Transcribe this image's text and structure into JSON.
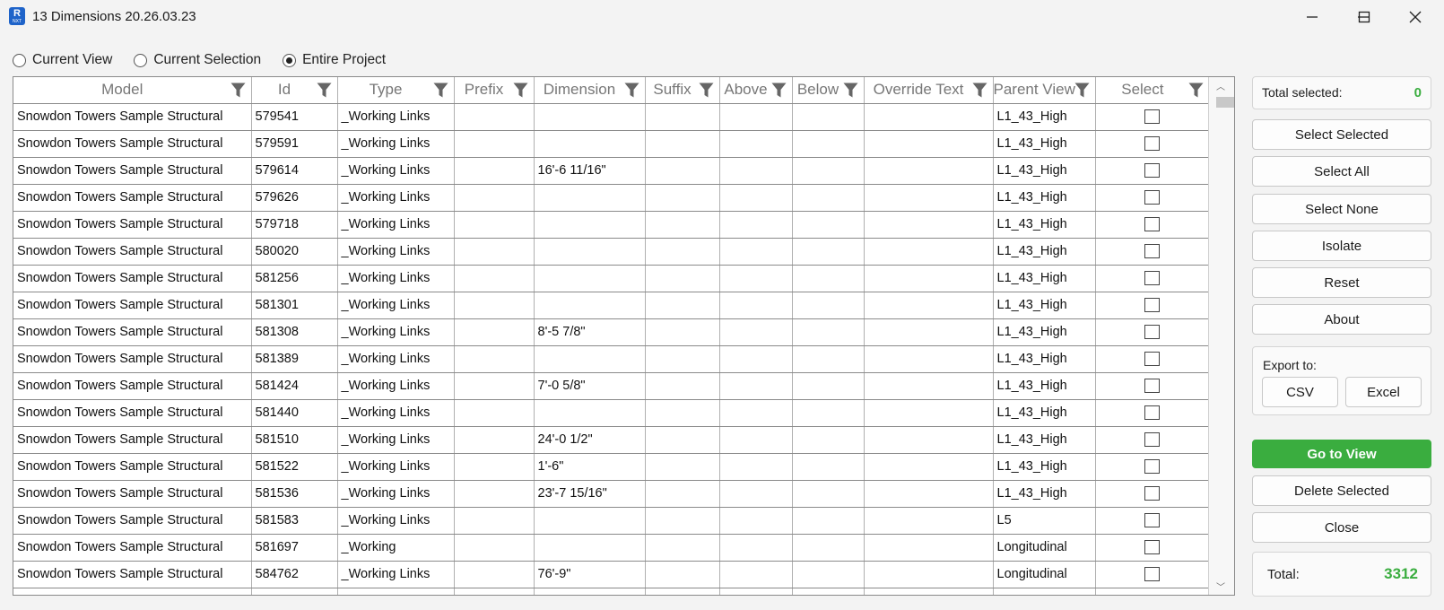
{
  "window": {
    "title": "13 Dimensions 20.26.03.23",
    "icon_letter": "R",
    "icon_sub": "NXT"
  },
  "scope": {
    "options": [
      {
        "label": "Current View",
        "checked": false
      },
      {
        "label": "Current Selection",
        "checked": false
      },
      {
        "label": "Entire Project",
        "checked": true
      }
    ]
  },
  "grid": {
    "columns": [
      "Model",
      "Id",
      "Type",
      "Prefix",
      "Dimension",
      "Suffix",
      "Above",
      "Below",
      "Override Text",
      "Parent View",
      "Select"
    ],
    "rows": [
      {
        "model": "Snowdon Towers Sample Structural",
        "id": "579541",
        "type": "_Working Links",
        "prefix": "",
        "dimension": "",
        "suffix": "",
        "above": "",
        "below": "",
        "override": "",
        "parent": "L1_43_High"
      },
      {
        "model": "Snowdon Towers Sample Structural",
        "id": "579591",
        "type": "_Working Links",
        "prefix": "",
        "dimension": "",
        "suffix": "",
        "above": "",
        "below": "",
        "override": "",
        "parent": "L1_43_High"
      },
      {
        "model": "Snowdon Towers Sample Structural",
        "id": "579614",
        "type": "_Working Links",
        "prefix": "",
        "dimension": "16'-6 11/16\"",
        "suffix": "",
        "above": "",
        "below": "",
        "override": "",
        "parent": "L1_43_High"
      },
      {
        "model": "Snowdon Towers Sample Structural",
        "id": "579626",
        "type": "_Working Links",
        "prefix": "",
        "dimension": "",
        "suffix": "",
        "above": "",
        "below": "",
        "override": "",
        "parent": "L1_43_High"
      },
      {
        "model": "Snowdon Towers Sample Structural",
        "id": "579718",
        "type": "_Working Links",
        "prefix": "",
        "dimension": "",
        "suffix": "",
        "above": "",
        "below": "",
        "override": "",
        "parent": "L1_43_High"
      },
      {
        "model": "Snowdon Towers Sample Structural",
        "id": "580020",
        "type": "_Working Links",
        "prefix": "",
        "dimension": "",
        "suffix": "",
        "above": "",
        "below": "",
        "override": "",
        "parent": "L1_43_High"
      },
      {
        "model": "Snowdon Towers Sample Structural",
        "id": "581256",
        "type": "_Working Links",
        "prefix": "",
        "dimension": "",
        "suffix": "",
        "above": "",
        "below": "",
        "override": "",
        "parent": "L1_43_High"
      },
      {
        "model": "Snowdon Towers Sample Structural",
        "id": "581301",
        "type": "_Working Links",
        "prefix": "",
        "dimension": "",
        "suffix": "",
        "above": "",
        "below": "",
        "override": "",
        "parent": "L1_43_High"
      },
      {
        "model": "Snowdon Towers Sample Structural",
        "id": "581308",
        "type": "_Working Links",
        "prefix": "",
        "dimension": "8'-5 7/8\"",
        "suffix": "",
        "above": "",
        "below": "",
        "override": "",
        "parent": "L1_43_High"
      },
      {
        "model": "Snowdon Towers Sample Structural",
        "id": "581389",
        "type": "_Working Links",
        "prefix": "",
        "dimension": "",
        "suffix": "",
        "above": "",
        "below": "",
        "override": "",
        "parent": "L1_43_High"
      },
      {
        "model": "Snowdon Towers Sample Structural",
        "id": "581424",
        "type": "_Working Links",
        "prefix": "",
        "dimension": "7'-0 5/8\"",
        "suffix": "",
        "above": "",
        "below": "",
        "override": "",
        "parent": "L1_43_High"
      },
      {
        "model": "Snowdon Towers Sample Structural",
        "id": "581440",
        "type": "_Working Links",
        "prefix": "",
        "dimension": "",
        "suffix": "",
        "above": "",
        "below": "",
        "override": "",
        "parent": "L1_43_High"
      },
      {
        "model": "Snowdon Towers Sample Structural",
        "id": "581510",
        "type": "_Working Links",
        "prefix": "",
        "dimension": "24'-0 1/2\"",
        "suffix": "",
        "above": "",
        "below": "",
        "override": "",
        "parent": "L1_43_High"
      },
      {
        "model": "Snowdon Towers Sample Structural",
        "id": "581522",
        "type": "_Working Links",
        "prefix": "",
        "dimension": "1'-6\"",
        "suffix": "",
        "above": "",
        "below": "",
        "override": "",
        "parent": "L1_43_High"
      },
      {
        "model": "Snowdon Towers Sample Structural",
        "id": "581536",
        "type": "_Working Links",
        "prefix": "",
        "dimension": "23'-7 15/16\"",
        "suffix": "",
        "above": "",
        "below": "",
        "override": "",
        "parent": "L1_43_High"
      },
      {
        "model": "Snowdon Towers Sample Structural",
        "id": "581583",
        "type": "_Working Links",
        "prefix": "",
        "dimension": "",
        "suffix": "",
        "above": "",
        "below": "",
        "override": "",
        "parent": "L5"
      },
      {
        "model": "Snowdon Towers Sample Structural",
        "id": "581697",
        "type": "_Working",
        "prefix": "",
        "dimension": "",
        "suffix": "",
        "above": "",
        "below": "",
        "override": "",
        "parent": "Longitudinal"
      },
      {
        "model": "Snowdon Towers Sample Structural",
        "id": "584762",
        "type": "_Working Links",
        "prefix": "",
        "dimension": "76'-9\"",
        "suffix": "",
        "above": "",
        "below": "",
        "override": "",
        "parent": "Longitudinal"
      }
    ]
  },
  "panel": {
    "total_selected_label": "Total selected:",
    "total_selected_value": "0",
    "buttons": {
      "select_selected": "Select Selected",
      "select_all": "Select All",
      "select_none": "Select None",
      "isolate": "Isolate",
      "reset": "Reset",
      "about": "About"
    },
    "export_label": "Export to:",
    "export_csv": "CSV",
    "export_excel": "Excel",
    "go_to_view": "Go to View",
    "delete_selected": "Delete Selected",
    "close": "Close",
    "total_label": "Total:",
    "total_value": "3312"
  },
  "colors": {
    "accent_green": "#3aad3f",
    "app_icon_blue": "#1e63c9"
  }
}
